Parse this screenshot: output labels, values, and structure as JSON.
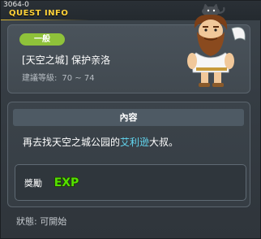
{
  "window": {
    "id": "3064-0",
    "title": "QUEST INFO"
  },
  "quest": {
    "category": "一般",
    "name": "[天空之城] 保护亲洛",
    "level_label": "建議等級:",
    "level_range": "70 ~ 74"
  },
  "content": {
    "header": "內容",
    "text_before": "再去找天空之城公园的",
    "npc_name": "艾利逊",
    "text_after": "大叔。"
  },
  "reward": {
    "label": "獎勵",
    "exp_icon_text": "EXP"
  },
  "status": "狀態: 可開始",
  "colors": {
    "title": "#ffd23a",
    "badge": "#8fc23a",
    "npc_highlight": "#62d6f0",
    "exp_green": "#55e000"
  },
  "icons": {
    "npc": "bearded-warrior-portrait-icon",
    "exp": "exp-icon"
  }
}
